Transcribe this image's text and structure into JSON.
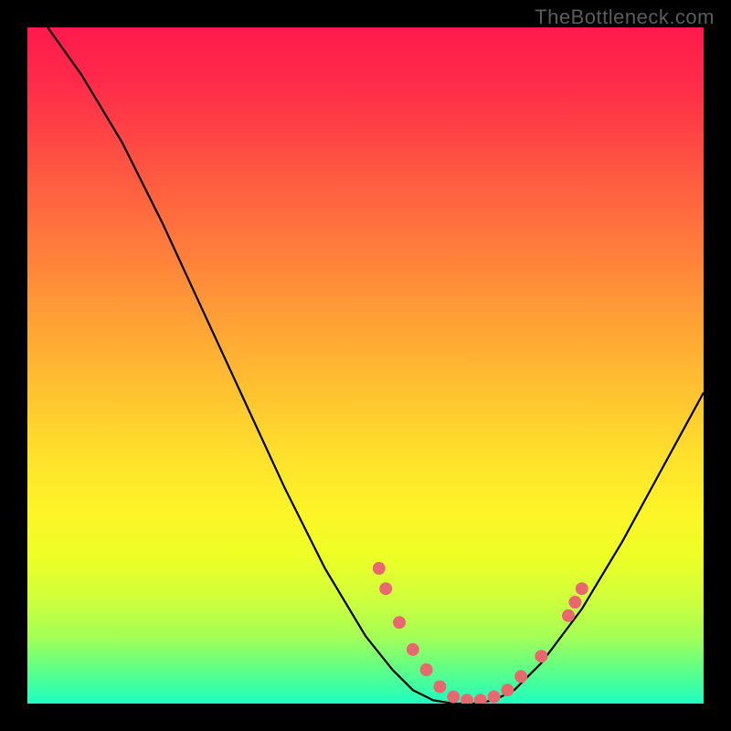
{
  "watermark": "TheBottleneck.com",
  "chart_data": {
    "type": "line",
    "title": "",
    "xlabel": "",
    "ylabel": "",
    "xlim": [
      0,
      100
    ],
    "ylim": [
      0,
      100
    ],
    "curve": [
      {
        "x": 3,
        "y": 100
      },
      {
        "x": 8,
        "y": 93
      },
      {
        "x": 14,
        "y": 83
      },
      {
        "x": 20,
        "y": 71
      },
      {
        "x": 26,
        "y": 58
      },
      {
        "x": 32,
        "y": 45
      },
      {
        "x": 38,
        "y": 32
      },
      {
        "x": 44,
        "y": 20
      },
      {
        "x": 50,
        "y": 10
      },
      {
        "x": 54,
        "y": 5
      },
      {
        "x": 57,
        "y": 2
      },
      {
        "x": 60,
        "y": 0.5
      },
      {
        "x": 63,
        "y": 0
      },
      {
        "x": 66,
        "y": 0
      },
      {
        "x": 69,
        "y": 0.5
      },
      {
        "x": 72,
        "y": 2
      },
      {
        "x": 76,
        "y": 6
      },
      {
        "x": 82,
        "y": 14
      },
      {
        "x": 88,
        "y": 24
      },
      {
        "x": 94,
        "y": 35
      },
      {
        "x": 100,
        "y": 46
      }
    ],
    "dots": [
      {
        "x": 52,
        "y": 20
      },
      {
        "x": 53,
        "y": 17
      },
      {
        "x": 55,
        "y": 12
      },
      {
        "x": 57,
        "y": 8
      },
      {
        "x": 59,
        "y": 5
      },
      {
        "x": 61,
        "y": 2.5
      },
      {
        "x": 63,
        "y": 1
      },
      {
        "x": 65,
        "y": 0.5
      },
      {
        "x": 67,
        "y": 0.5
      },
      {
        "x": 69,
        "y": 1
      },
      {
        "x": 71,
        "y": 2
      },
      {
        "x": 73,
        "y": 4
      },
      {
        "x": 76,
        "y": 7
      },
      {
        "x": 80,
        "y": 13
      },
      {
        "x": 81,
        "y": 15
      },
      {
        "x": 82,
        "y": 17
      }
    ],
    "colors": {
      "curve": "#000000",
      "dots": "#e86870"
    }
  }
}
